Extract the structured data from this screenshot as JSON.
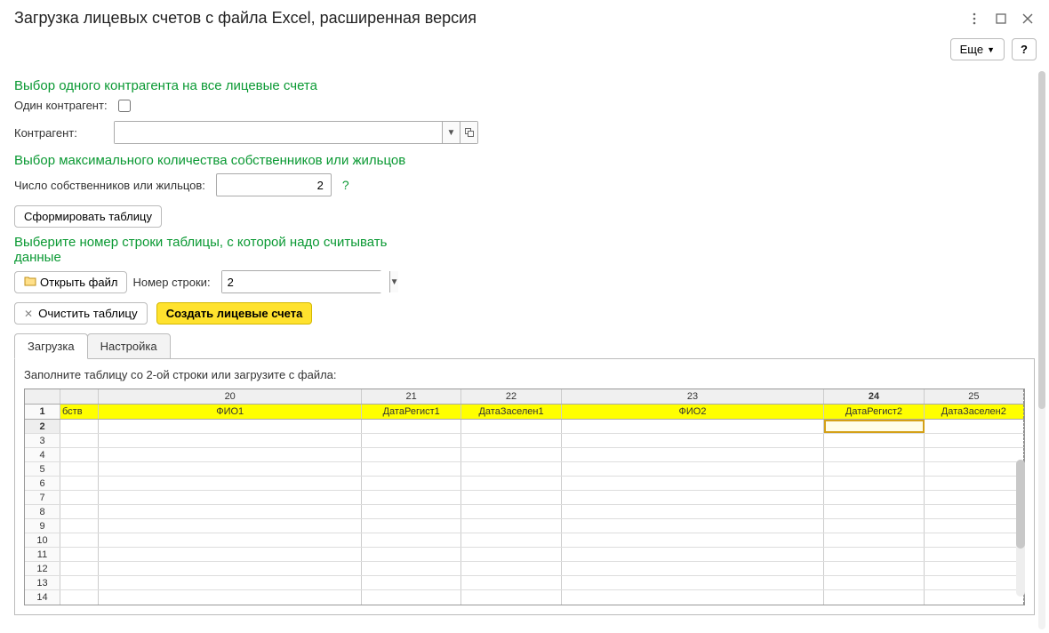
{
  "titlebar": {
    "title": "Загрузка лицевых счетов с файла Excel, расширенная версия"
  },
  "toolbar": {
    "more_label": "Еще",
    "help_label": "?"
  },
  "section1": {
    "title": "Выбор одного контрагента на все лицевые счета",
    "single_label": "Один контрагент:",
    "counterparty_label": "Контрагент:"
  },
  "section2": {
    "title": "Выбор максимального количества собственников или жильцов",
    "count_label": "Число собственников или жильцов:",
    "count_value": "2"
  },
  "form_table_btn": "Сформировать таблицу",
  "section3": {
    "title": "Выберите номер строки таблицы, с которой надо считывать данные",
    "open_file_label": "Открыть файл",
    "rownum_label": "Номер строки:",
    "rownum_value": "2"
  },
  "actions": {
    "clear_label": "Очистить таблицу",
    "create_label": "Создать лицевые счета"
  },
  "tabs": {
    "t1": "Загрузка",
    "t2": "Настройка"
  },
  "table": {
    "hint": "Заполните таблицу со 2-ой строки или загрузите с файла:",
    "col_nums": [
      "20",
      "21",
      "22",
      "23",
      "24",
      "25"
    ],
    "subheaders": [
      "бств",
      "ФИО1",
      "ДатаРегист1",
      "ДатаЗаселен1",
      "ФИО2",
      "ДатаРегист2",
      "ДатаЗаселен2"
    ],
    "active_col_index": 4,
    "active_row": 2,
    "row_numbers": [
      "1",
      "2",
      "3",
      "4",
      "5",
      "6",
      "7",
      "8",
      "9",
      "10",
      "11",
      "12",
      "13",
      "14"
    ]
  }
}
